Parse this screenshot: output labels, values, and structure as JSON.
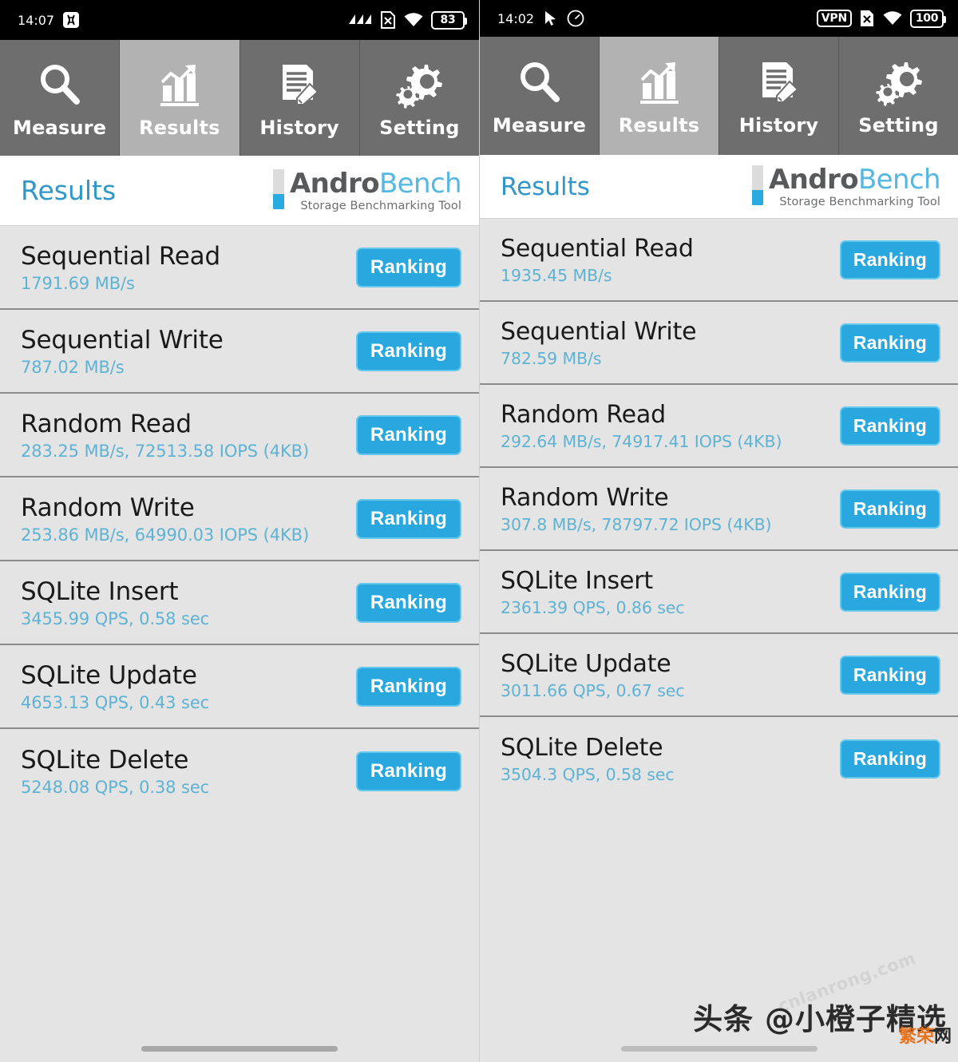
{
  "panels": [
    {
      "statusbar": {
        "time": "14:07",
        "left_icons": [
          "dna-icon"
        ],
        "right_icons": [
          "signal-bars-icon",
          "sim-disabled-icon",
          "wifi-icon"
        ],
        "battery": "83"
      },
      "tabs": [
        {
          "label": "Measure",
          "icon": "magnifier-icon",
          "selected": false
        },
        {
          "label": "Results",
          "icon": "bar-chart-arrow-icon",
          "selected": true
        },
        {
          "label": "History",
          "icon": "document-pencil-icon",
          "selected": false
        },
        {
          "label": "Setting",
          "icon": "gears-icon",
          "selected": false
        }
      ],
      "header": {
        "title": "Results",
        "logo_main_a": "Andro",
        "logo_main_b": "Bench",
        "logo_sub": "Storage Benchmarking Tool"
      },
      "rows": [
        {
          "title": "Sequential Read",
          "value": "1791.69 MB/s",
          "button": "Ranking"
        },
        {
          "title": "Sequential Write",
          "value": "787.02 MB/s",
          "button": "Ranking"
        },
        {
          "title": "Random Read",
          "value": "283.25 MB/s, 72513.58 IOPS (4KB)",
          "button": "Ranking"
        },
        {
          "title": "Random Write",
          "value": "253.86 MB/s, 64990.03 IOPS (4KB)",
          "button": "Ranking"
        },
        {
          "title": "SQLite Insert",
          "value": "3455.99 QPS, 0.58 sec",
          "button": "Ranking"
        },
        {
          "title": "SQLite Update",
          "value": "4653.13 QPS, 0.43 sec",
          "button": "Ranking"
        },
        {
          "title": "SQLite Delete",
          "value": "5248.08 QPS, 0.38 sec",
          "button": "Ranking"
        }
      ],
      "watermarks": {}
    },
    {
      "statusbar": {
        "time": "14:02",
        "left_icons": [
          "cursor-icon",
          "clock-icon"
        ],
        "right_icons": [
          "vpn-badge",
          "sim-disabled-icon",
          "wifi-icon"
        ],
        "vpn_label": "VPN",
        "battery": "100"
      },
      "tabs": [
        {
          "label": "Measure",
          "icon": "magnifier-icon",
          "selected": false
        },
        {
          "label": "Results",
          "icon": "bar-chart-arrow-icon",
          "selected": true
        },
        {
          "label": "History",
          "icon": "document-pencil-icon",
          "selected": false
        },
        {
          "label": "Setting",
          "icon": "gears-icon",
          "selected": false
        }
      ],
      "header": {
        "title": "Results",
        "logo_main_a": "Andro",
        "logo_main_b": "Bench",
        "logo_sub": "Storage Benchmarking Tool"
      },
      "rows": [
        {
          "title": "Sequential Read",
          "value": "1935.45 MB/s",
          "button": "Ranking"
        },
        {
          "title": "Sequential Write",
          "value": "782.59 MB/s",
          "button": "Ranking"
        },
        {
          "title": "Random Read",
          "value": "292.64 MB/s, 74917.41 IOPS (4KB)",
          "button": "Ranking"
        },
        {
          "title": "Random Write",
          "value": "307.8 MB/s, 78797.72 IOPS (4KB)",
          "button": "Ranking"
        },
        {
          "title": "SQLite Insert",
          "value": "2361.39 QPS, 0.86 sec",
          "button": "Ranking"
        },
        {
          "title": "SQLite Update",
          "value": "3011.66 QPS, 0.67 sec",
          "button": "Ranking"
        },
        {
          "title": "SQLite Delete",
          "value": "3504.3 QPS, 0.58 sec",
          "button": "Ranking"
        }
      ],
      "watermarks": {
        "rotated": "cnlanrong.com",
        "main": "头条 @小橙子精选",
        "small_orange": "繁荣",
        "small_dark": "网"
      }
    }
  ],
  "colors": {
    "accent_blue": "#29a8e0",
    "value_blue": "#5eb3d4",
    "title_blue": "#2f97c9",
    "tab_bg": "#6e6e6e",
    "tab_selected_bg": "#b2b2b2",
    "row_bg": "#e4e4e4",
    "row_divider": "#8c8c8c",
    "watermark_orange": "#e8721c"
  }
}
